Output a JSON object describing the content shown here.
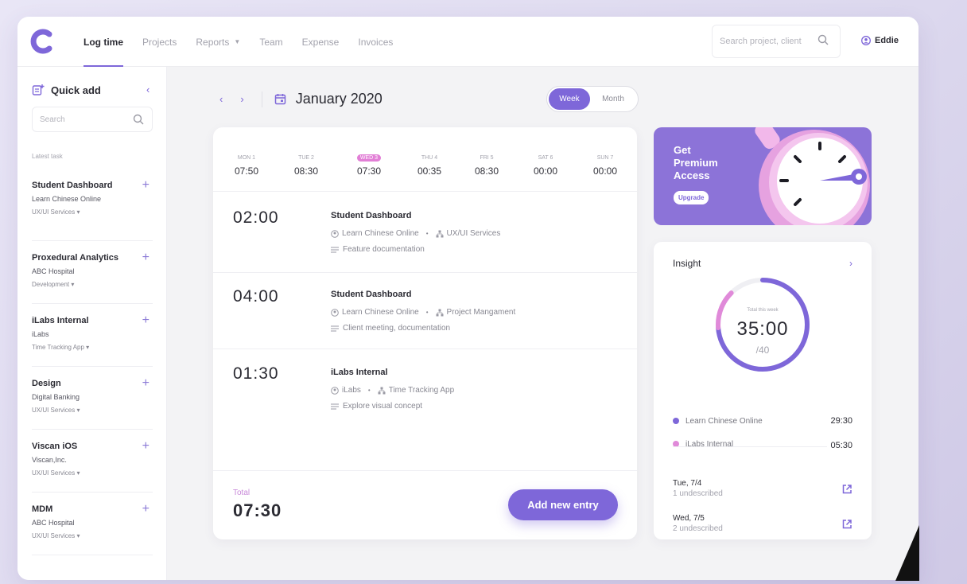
{
  "nav": {
    "items": [
      {
        "label": "Log time",
        "active": true
      },
      {
        "label": "Projects"
      },
      {
        "label": "Reports",
        "dropdown": true
      },
      {
        "label": "Team"
      },
      {
        "label": "Expense"
      },
      {
        "label": "Invoices"
      }
    ],
    "search_placeholder": "Search project, client",
    "user": "Eddie"
  },
  "sidebar": {
    "title": "Quick add",
    "search_placeholder": "Search",
    "section_label": "Latest task",
    "tasks": [
      {
        "name": "Student Dashboard",
        "client": "Learn Chinese Online",
        "service": "UX/UI Services"
      },
      {
        "name": "Proxedural Analytics",
        "client": "ABC Hospital",
        "service": "Development"
      },
      {
        "name": "iLabs Internal",
        "client": "iLabs",
        "service": "Time Tracking App"
      },
      {
        "name": "Design",
        "client": "Digital Banking",
        "service": "UX/UI Services"
      },
      {
        "name": "Viscan iOS",
        "client": "Viscan,Inc.",
        "service": "UX/UI Services"
      },
      {
        "name": "MDM",
        "client": "ABC Hospital",
        "service": "UX/UI Services"
      }
    ]
  },
  "header": {
    "month": "January 2020",
    "view_week": "Week",
    "view_month": "Month"
  },
  "days": [
    {
      "label": "MON 1",
      "time": "07:50"
    },
    {
      "label": "TUE 2",
      "time": "08:30"
    },
    {
      "label": "WED 3",
      "time": "07:30",
      "today": true
    },
    {
      "label": "THU 4",
      "time": "00:35"
    },
    {
      "label": "FRI 5",
      "time": "08:30"
    },
    {
      "label": "SAT 6",
      "time": "00:00"
    },
    {
      "label": "SUN 7",
      "time": "00:00"
    }
  ],
  "entries": [
    {
      "duration": "02:00",
      "title": "Student Dashboard",
      "client": "Learn Chinese Online",
      "service": "UX/UI Services",
      "description": "Feature documentation"
    },
    {
      "duration": "04:00",
      "title": "Student Dashboard",
      "client": "Learn Chinese Online",
      "service": "Project Mangament",
      "description": "Client meeting, documentation"
    },
    {
      "duration": "01:30",
      "title": "iLabs Internal",
      "client": "iLabs",
      "service": "Time Tracking App",
      "description": "Explore visual concept"
    }
  ],
  "footer": {
    "total_label": "Total",
    "total_value": "07:30",
    "add_button": "Add new entry"
  },
  "premium": {
    "text": "Get Premium Access",
    "button": "Upgrade"
  },
  "insight": {
    "title": "Insight",
    "ring_label": "Total this week",
    "total": "35:00",
    "max": "/40",
    "progress": 0.875,
    "breakdown": [
      {
        "name": "Learn Chinese Online",
        "value": "29:30",
        "color": "#7e67d9",
        "fraction": 0.7375
      },
      {
        "name": "iLabs Internal",
        "value": "05:30",
        "color": "#e08ad9",
        "fraction": 0.1375
      }
    ],
    "undescribed": [
      {
        "day": "Tue, 7/4",
        "note": "1 undescribed"
      },
      {
        "day": "Wed, 7/5",
        "note": "2 undescribed"
      }
    ]
  },
  "colors": {
    "accent": "#7e67d9",
    "pink": "#e08ad9"
  }
}
